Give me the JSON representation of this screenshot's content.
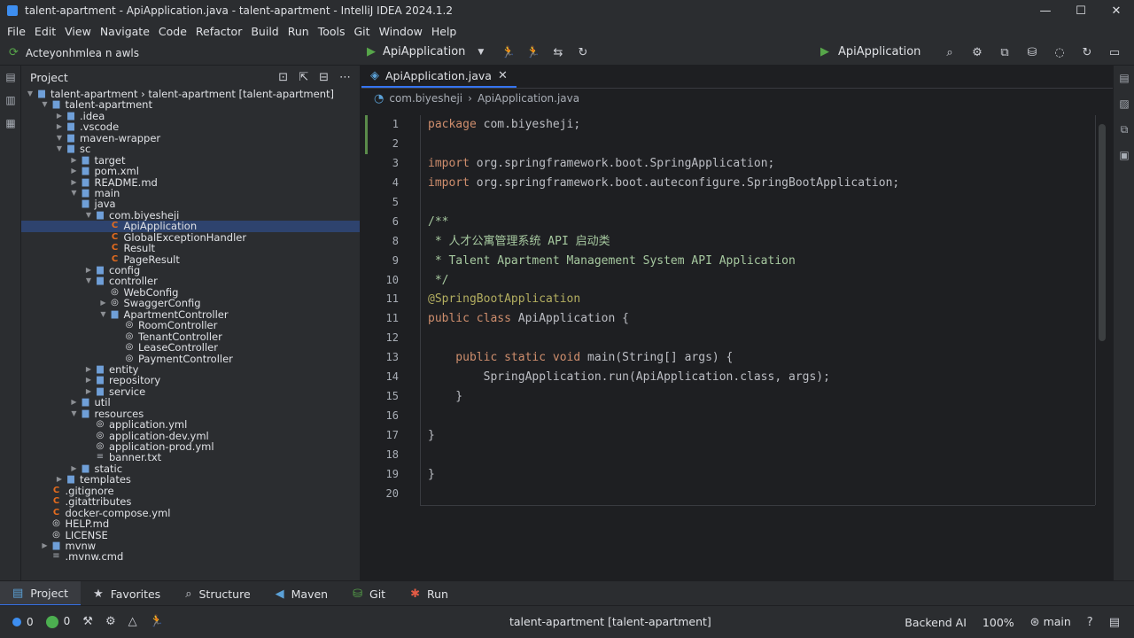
{
  "window": {
    "title": "talent-apartment - ApiApplication.java - talent-apartment - IntelliJ IDEA 2024.1.2",
    "controls": [
      "—",
      "☐",
      "✕"
    ]
  },
  "menu": [
    "File",
    "Edit",
    "View",
    "Navigate",
    "Code",
    "Refactor",
    "Build",
    "Run",
    "Tools",
    "Git",
    "Window",
    "Help"
  ],
  "toolbar": {
    "branch_label": "Acteyonhmlea n awls",
    "run_config": "ApiApplication",
    "right_run_config": "ApiApplication"
  },
  "project": {
    "title": "Project",
    "tree": [
      {
        "label": "talent-apartment › talent-apartment [talent-apartment]",
        "indent": 0,
        "arrow": "▼",
        "icon": "folder"
      },
      {
        "label": "talent-apartment",
        "indent": 1,
        "arrow": "▼",
        "icon": "folder"
      },
      {
        "label": ".idea",
        "indent": 2,
        "arrow": "▶",
        "icon": "folder"
      },
      {
        "label": ".vscode",
        "indent": 2,
        "arrow": "▶",
        "icon": "folder"
      },
      {
        "label": "maven-wrapper",
        "indent": 2,
        "arrow": "▼",
        "icon": "folder"
      },
      {
        "label": "sc",
        "indent": 2,
        "arrow": "▼",
        "icon": "folder"
      },
      {
        "label": "target",
        "indent": 3,
        "arrow": "▶",
        "icon": "folder"
      },
      {
        "label": "pom.xml",
        "indent": 3,
        "arrow": "▶",
        "icon": "folder"
      },
      {
        "label": "README.md",
        "indent": 3,
        "arrow": "▶",
        "icon": "folder"
      },
      {
        "label": "main",
        "indent": 3,
        "arrow": "▼",
        "icon": "folder"
      },
      {
        "label": "java",
        "indent": 3,
        "arrow": "",
        "icon": "folder"
      },
      {
        "label": "com.biyesheji",
        "indent": 4,
        "arrow": "▼",
        "icon": "folder"
      },
      {
        "label": "ApiApplication",
        "indent": 5,
        "arrow": "",
        "icon": "class",
        "selected": true
      },
      {
        "label": "GlobalExceptionHandler",
        "indent": 5,
        "arrow": "",
        "icon": "class"
      },
      {
        "label": "Result",
        "indent": 5,
        "arrow": "",
        "icon": "class"
      },
      {
        "label": "PageResult",
        "indent": 5,
        "arrow": "",
        "icon": "class"
      },
      {
        "label": "config",
        "indent": 4,
        "arrow": "▶",
        "icon": "folder"
      },
      {
        "label": "controller",
        "indent": 4,
        "arrow": "▼",
        "icon": "folder"
      },
      {
        "label": "WebConfig",
        "indent": 5,
        "arrow": "",
        "icon": "spring"
      },
      {
        "label": "SwaggerConfig",
        "indent": 5,
        "arrow": "▶",
        "icon": "spring"
      },
      {
        "label": "ApartmentController",
        "indent": 5,
        "arrow": "▼",
        "icon": "folder-spring"
      },
      {
        "label": "RoomController",
        "indent": 6,
        "arrow": "",
        "icon": "spring"
      },
      {
        "label": "TenantController",
        "indent": 6,
        "arrow": "",
        "icon": "spring"
      },
      {
        "label": "LeaseController",
        "indent": 6,
        "arrow": "",
        "icon": "spring"
      },
      {
        "label": "PaymentController",
        "indent": 6,
        "arrow": "",
        "icon": "spring"
      },
      {
        "label": "entity",
        "indent": 4,
        "arrow": "▶",
        "icon": "folder"
      },
      {
        "label": "repository",
        "indent": 4,
        "arrow": "▶",
        "icon": "folder"
      },
      {
        "label": "service",
        "indent": 4,
        "arrow": "▶",
        "icon": "folder"
      },
      {
        "label": "util",
        "indent": 3,
        "arrow": "▶",
        "icon": "folder"
      },
      {
        "label": "resources",
        "indent": 3,
        "arrow": "▼",
        "icon": "folder"
      },
      {
        "label": "application.yml",
        "indent": 4,
        "arrow": "",
        "icon": "spring"
      },
      {
        "label": "application-dev.yml",
        "indent": 4,
        "arrow": "",
        "icon": "spring"
      },
      {
        "label": "application-prod.yml",
        "indent": 4,
        "arrow": "",
        "icon": "spring"
      },
      {
        "label": "banner.txt",
        "indent": 4,
        "arrow": "",
        "icon": "text"
      },
      {
        "label": "static",
        "indent": 3,
        "arrow": "▶",
        "icon": "folder"
      },
      {
        "label": "templates",
        "indent": 2,
        "arrow": "▶",
        "icon": "folder"
      },
      {
        "label": ".gitignore",
        "indent": 1,
        "arrow": "",
        "icon": "class"
      },
      {
        "label": ".gitattributes",
        "indent": 1,
        "arrow": "",
        "icon": "class"
      },
      {
        "label": "docker-compose.yml",
        "indent": 1,
        "arrow": "",
        "icon": "class"
      },
      {
        "label": "HELP.md",
        "indent": 1,
        "arrow": "",
        "icon": "spring"
      },
      {
        "label": "LICENSE",
        "indent": 1,
        "arrow": "",
        "icon": "spring"
      },
      {
        "label": "mvnw",
        "indent": 1,
        "arrow": "▶",
        "icon": "folder"
      },
      {
        "label": ".mvnw.cmd",
        "indent": 1,
        "arrow": "",
        "icon": "text"
      }
    ]
  },
  "editor": {
    "tab_label": "ApiApplication.java",
    "breadcrumbs": [
      "com.biyesheji",
      "ApiApplication.java"
    ],
    "line_numbers": [
      "1",
      "2",
      "3",
      "4",
      "5",
      "6",
      "8",
      "9",
      "10",
      "11",
      "11",
      "12",
      "13",
      "14",
      "15",
      "16",
      "17",
      "18",
      "19",
      "20"
    ],
    "code": [
      [
        {
          "t": "package",
          "c": "kw"
        },
        {
          "t": " com.biyesheji;",
          "c": ""
        }
      ],
      [],
      [
        {
          "t": "import",
          "c": "kw"
        },
        {
          "t": " org.springframework.boot.SpringApplication;",
          "c": ""
        }
      ],
      [
        {
          "t": "import",
          "c": "kw"
        },
        {
          "t": " org.springframework.boot.auteconfigure.SpringBootApplication;",
          "c": ""
        }
      ],
      [],
      [
        {
          "t": "/**",
          "c": "cm"
        }
      ],
      [
        {
          "t": " * 人才公寓管理系统 API 启动类",
          "c": "cm"
        }
      ],
      [
        {
          "t": " * Talent Apartment Management System API Application",
          "c": "cm"
        }
      ],
      [
        {
          "t": " */",
          "c": "cm"
        }
      ],
      [
        {
          "t": "@SpringBootApplication",
          "c": "an"
        }
      ],
      [
        {
          "t": "public class",
          "c": "kw"
        },
        {
          "t": " ApiApplication {",
          "c": ""
        }
      ],
      [],
      [
        {
          "t": "    public static void",
          "c": "kw"
        },
        {
          "t": " main(String[] args) {",
          "c": ""
        }
      ],
      [
        {
          "t": "        SpringApplication.run(ApiApplication.class, args);",
          "c": ""
        }
      ],
      [
        {
          "t": "    }",
          "c": ""
        }
      ],
      [],
      [
        {
          "t": "}",
          "c": ""
        }
      ],
      [],
      [
        {
          "t": "}",
          "c": ""
        }
      ],
      []
    ]
  },
  "bottom_tabs": [
    "Project",
    "Favorites",
    "Structure",
    "Maven",
    "Git",
    "Run"
  ],
  "status": {
    "errors": "0",
    "checks": "0",
    "center": "talent-apartment [talent-apartment]",
    "ai": "Backend AI",
    "zoom": "100%",
    "branch": "main"
  },
  "colors": {
    "accent": "#3574f0",
    "run_green": "#57a64a",
    "error_blue": "#3d8ef0",
    "ok_green": "#4caf50"
  }
}
